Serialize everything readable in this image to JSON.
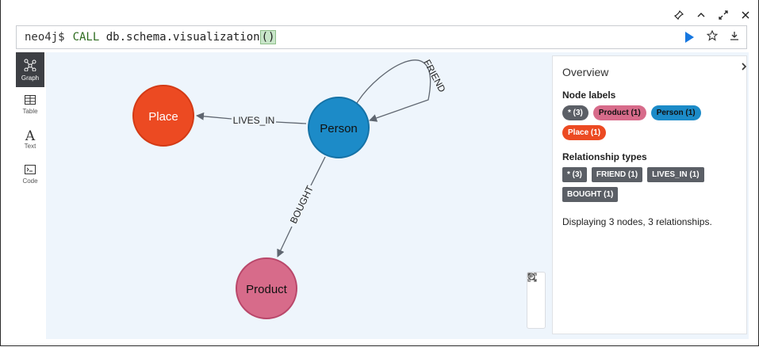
{
  "editor": {
    "prompt": "neo4j$",
    "query_keyword": "CALL",
    "query_name": "db.schema.visualization",
    "query_parens": "()"
  },
  "sidebar": {
    "items": [
      {
        "label": "Graph",
        "icon": "graph-icon"
      },
      {
        "label": "Table",
        "icon": "table-icon"
      },
      {
        "label": "Text",
        "icon": "text-icon"
      },
      {
        "label": "Code",
        "icon": "code-icon"
      }
    ]
  },
  "graph": {
    "nodes": [
      {
        "label": "Place",
        "color": "#ec4a22"
      },
      {
        "label": "Person",
        "color": "#1c8bc8"
      },
      {
        "label": "Product",
        "color": "#d76b8a"
      }
    ],
    "relationships": [
      {
        "label": "LIVES_IN"
      },
      {
        "label": "FRIEND"
      },
      {
        "label": "BOUGHT"
      }
    ]
  },
  "overview": {
    "title": "Overview",
    "node_labels_heading": "Node labels",
    "node_labels": [
      {
        "text": "* (3)",
        "color": "#5b5f66"
      },
      {
        "text": "Product (1)",
        "color": "#d76b8a"
      },
      {
        "text": "Person (1)",
        "color": "#1c8bc8"
      },
      {
        "text": "Place (1)",
        "color": "#ec4a22"
      }
    ],
    "relationship_types_heading": "Relationship types",
    "relationship_types": [
      {
        "text": "* (3)"
      },
      {
        "text": "FRIEND (1)"
      },
      {
        "text": "LIVES_IN (1)"
      },
      {
        "text": "BOUGHT (1)"
      }
    ],
    "summary": "Displaying 3 nodes, 3 relationships."
  }
}
